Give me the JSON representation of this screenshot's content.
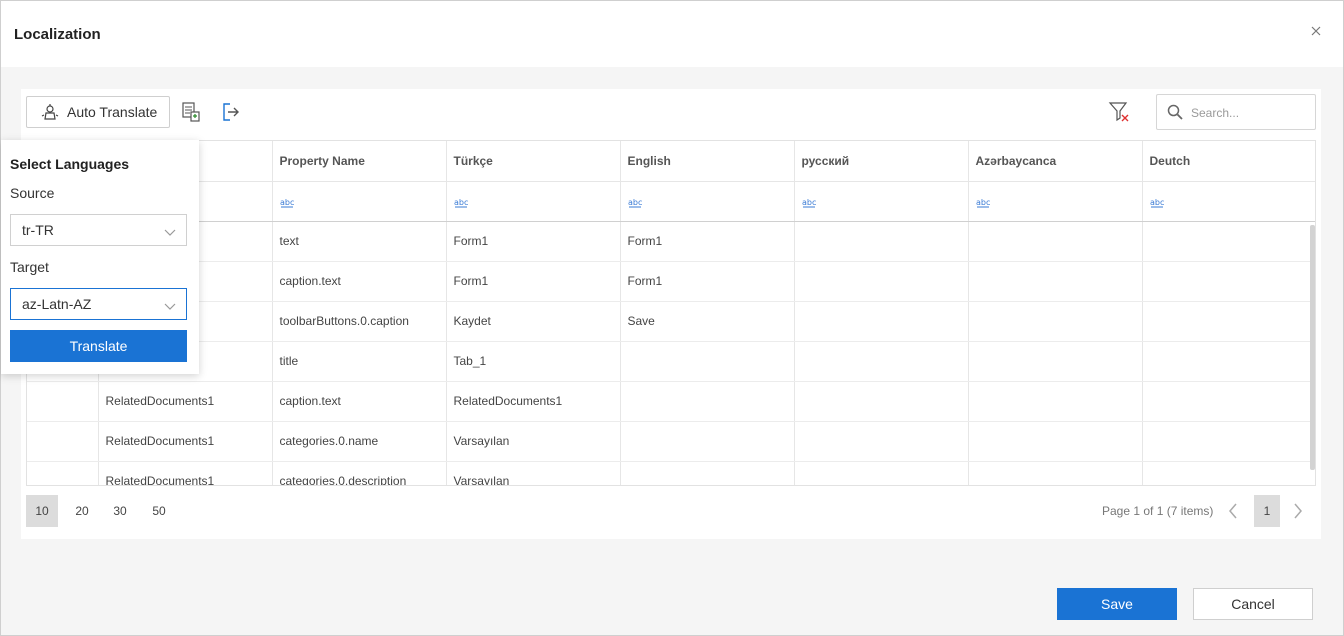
{
  "dialog": {
    "title": "Localization"
  },
  "toolbar": {
    "auto_translate_label": "Auto Translate",
    "search_placeholder": "Search..."
  },
  "grid": {
    "columns": [
      "",
      "",
      "Property Name",
      "Türkçe",
      "English",
      "русский",
      "Azərbaycanca",
      "Deutch"
    ],
    "rows": [
      [
        "",
        "",
        "text",
        "Form1",
        "Form1",
        "",
        "",
        ""
      ],
      [
        "",
        "",
        "caption.text",
        "Form1",
        "Form1",
        "",
        "",
        ""
      ],
      [
        "",
        "",
        "toolbarButtons.0.caption",
        "Kaydet",
        "Save",
        "",
        "",
        ""
      ],
      [
        "",
        "",
        "title",
        "Tab_1",
        "",
        "",
        "",
        ""
      ],
      [
        "",
        "RelatedDocuments1",
        "caption.text",
        "RelatedDocuments1",
        "",
        "",
        "",
        ""
      ],
      [
        "",
        "RelatedDocuments1",
        "categories.0.name",
        "Varsayılan",
        "",
        "",
        "",
        ""
      ],
      [
        "",
        "RelatedDocuments1",
        "categories.0.description",
        "Varsayılan",
        "",
        "",
        "",
        ""
      ]
    ]
  },
  "pager": {
    "sizes": [
      "10",
      "20",
      "30",
      "50"
    ],
    "active_size": "10",
    "info": "Page 1 of 1 (7 items)",
    "current_page": "1"
  },
  "popup": {
    "title": "Select Languages",
    "source_label": "Source",
    "source_value": "tr-TR",
    "target_label": "Target",
    "target_value": "az-Latn-AZ",
    "translate_label": "Translate"
  },
  "footer": {
    "save_label": "Save",
    "cancel_label": "Cancel"
  },
  "colors": {
    "accent": "#1a73d4",
    "filter_clear_x": "#e03030"
  }
}
